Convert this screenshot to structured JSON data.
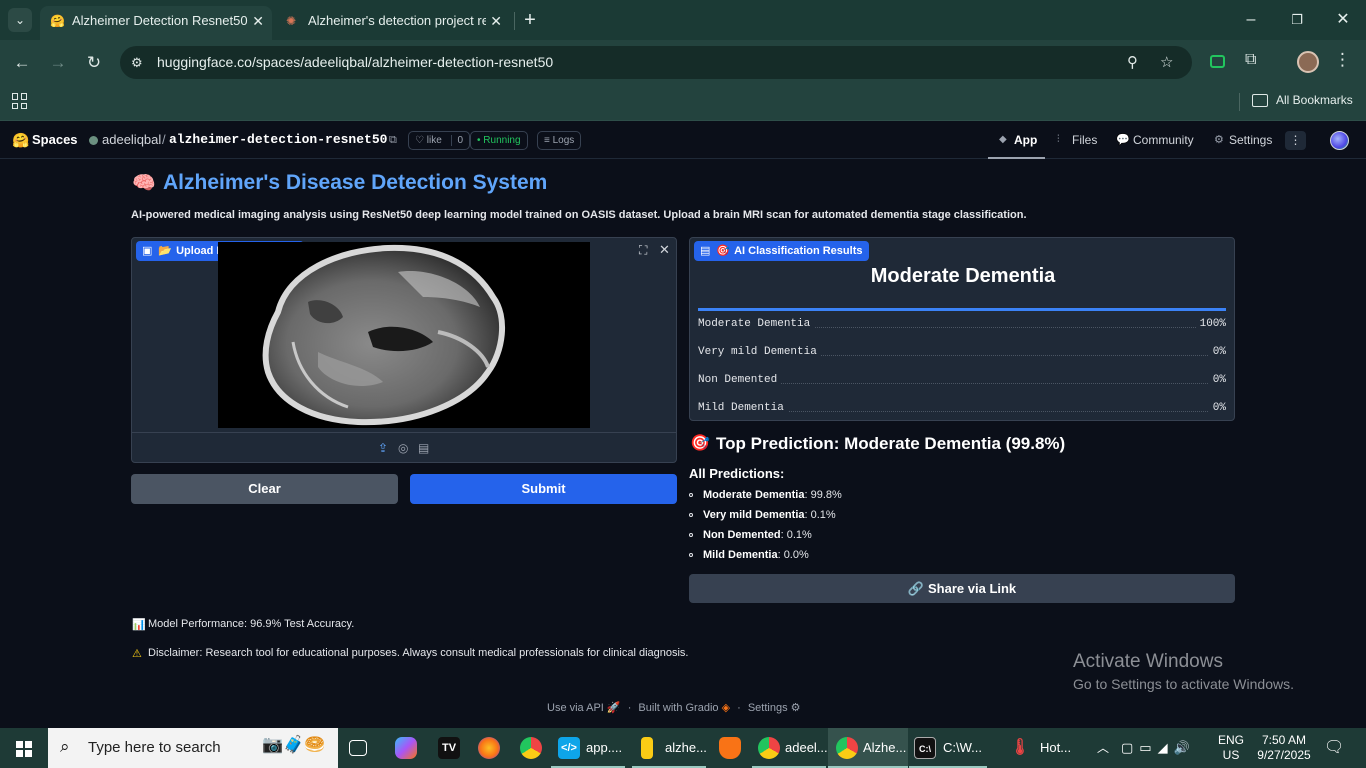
{
  "browser": {
    "tabs": [
      {
        "title": "Alzheimer Detection Resnet50 -",
        "favicon": "huggingface-icon",
        "active": true
      },
      {
        "title": "Alzheimer's detection project re",
        "favicon": "claude-icon",
        "active": false
      }
    ],
    "url": "huggingface.co/spaces/adeeliqbal/alzheimer-detection-resnet50",
    "bookmarks_label": "All Bookmarks"
  },
  "hf": {
    "spaces_label": "Spaces",
    "owner": "adeeliqbal",
    "separator": "/",
    "repo": "alzheimer-detection-resnet50",
    "like_label": "like",
    "like_count": "0",
    "status": "Running",
    "logs_label": "Logs",
    "nav": {
      "app": "App",
      "files": "Files",
      "community": "Community",
      "settings": "Settings"
    }
  },
  "app": {
    "title_emoji": "🧠",
    "title": "Alzheimer's Disease Detection System",
    "subtitle": "AI-powered medical imaging analysis using ResNet50 deep learning model trained on OASIS dataset. Upload a brain MRI scan for automated dementia stage classification.",
    "upload_label": "Upload Brain MRI Scan",
    "results_label": "AI Classification Results",
    "top_label": "Moderate Dementia",
    "confidences": [
      {
        "label": "Moderate Dementia",
        "value": "100%",
        "fraction": 1.0
      },
      {
        "label": "Very mild Dementia",
        "value": "0%",
        "fraction": 0.0
      },
      {
        "label": "Non Demented",
        "value": "0%",
        "fraction": 0.0
      },
      {
        "label": "Mild Dementia",
        "value": "0%",
        "fraction": 0.0
      }
    ],
    "clear_label": "Clear",
    "submit_label": "Submit",
    "top_prediction": "Top Prediction: Moderate Dementia (99.8%)",
    "all_predictions_heading": "All Predictions:",
    "predictions": [
      {
        "name": "Moderate Dementia",
        "value": ": 99.8%"
      },
      {
        "name": "Very mild Dementia",
        "value": ": 0.1%"
      },
      {
        "name": "Non Demented",
        "value": ": 0.1%"
      },
      {
        "name": "Mild Dementia",
        "value": ": 0.0%"
      }
    ],
    "share_label": "Share via Link",
    "performance": "Model Performance: 96.9% Test Accuracy.",
    "disclaimer": "Disclaimer: Research tool for educational purposes. Always consult medical professionals for clinical diagnosis.",
    "footer": {
      "api": "Use via API",
      "built": "Built with Gradio",
      "settings": "Settings",
      "sep": "·"
    }
  },
  "watermark": {
    "title": "Activate Windows",
    "subtitle": "Go to Settings to activate Windows."
  },
  "taskbar": {
    "search_placeholder": "Type here to search",
    "items": [
      "app....",
      "alzhe...",
      "adeel...",
      "Alzhe...",
      "C:\\W...",
      "Hot..."
    ],
    "lang": "ENG",
    "region": "US",
    "time": "7:50 AM",
    "date": "9/27/2025"
  },
  "colors": {
    "accent": "#2563eb",
    "hf_bg": "#0b0f19",
    "panel": "#1f2937",
    "title_blue": "#60a5fa",
    "running": "#22c55e"
  }
}
